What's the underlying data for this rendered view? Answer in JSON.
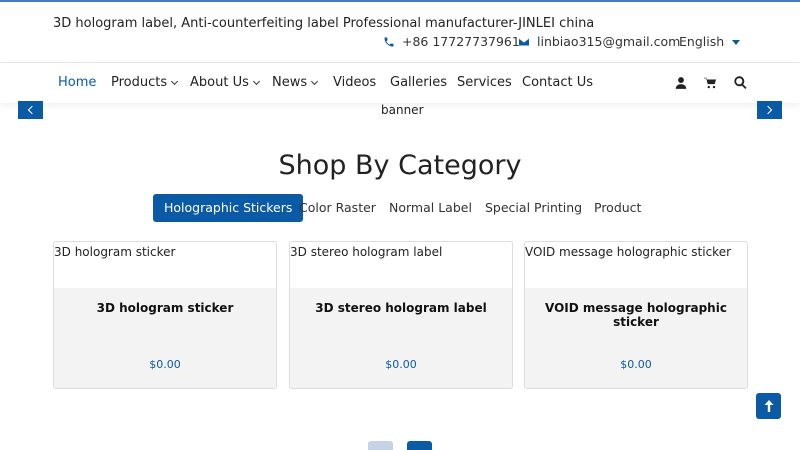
{
  "header": {
    "site_title": "3D hologram label, Anti-counterfeiting label Professional manufacturer-JINLEI china",
    "phone": "+86 17727737961",
    "email": "linbiao315@gmail.com",
    "language": "English"
  },
  "nav": {
    "items": [
      {
        "label": "Home",
        "has_dropdown": false,
        "active": true
      },
      {
        "label": "Products",
        "has_dropdown": true
      },
      {
        "label": "About Us",
        "has_dropdown": true
      },
      {
        "label": "News",
        "has_dropdown": true
      },
      {
        "label": "Videos",
        "has_dropdown": false
      },
      {
        "label": "Galleries",
        "has_dropdown": false
      },
      {
        "label": "Services",
        "has_dropdown": false
      },
      {
        "label": "Contact Us",
        "has_dropdown": false
      }
    ],
    "icons": [
      "user-icon",
      "cart-icon",
      "search-icon"
    ]
  },
  "banner": {
    "alt_text": "banner"
  },
  "category_section": {
    "title": "Shop By Category",
    "tabs": [
      {
        "label": "Holographic Stickers",
        "active": true
      },
      {
        "label": "Color Raster"
      },
      {
        "label": "Normal Label"
      },
      {
        "label": "Special Printing"
      },
      {
        "label": "Product"
      }
    ],
    "products": [
      {
        "image_alt": "3D hologram sticker",
        "name": "3D hologram sticker",
        "price": "$0.00"
      },
      {
        "image_alt": "3D stereo hologram label",
        "name": "3D stereo hologram label",
        "price": "$0.00"
      },
      {
        "image_alt": "VOID message holographic sticker",
        "name": "VOID message holographic sticker",
        "price": "$0.00"
      }
    ]
  },
  "colors": {
    "accent": "#0b5aa6",
    "card_body": "#f3f3f3",
    "pager_inactive": "#c4d3e6"
  }
}
